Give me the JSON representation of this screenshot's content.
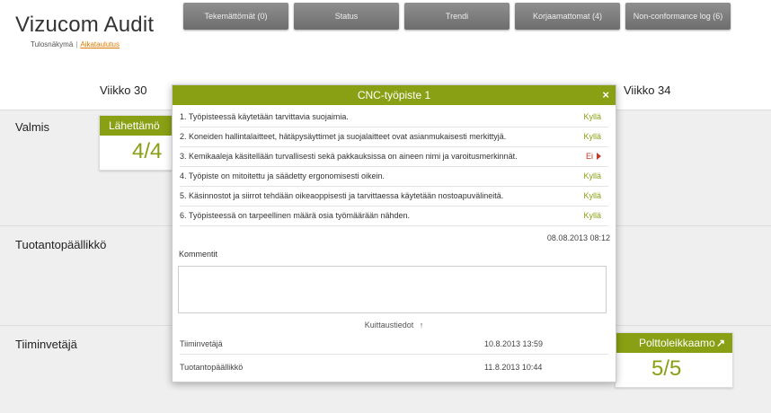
{
  "header": {
    "app_title": "Vizucom Audit",
    "subnav": {
      "current": "Tulosnäkymä",
      "separator": "|",
      "link": "Aikataulutus"
    },
    "tabs": [
      {
        "label": "Tekemättömät (0)"
      },
      {
        "label": "Status"
      },
      {
        "label": "Trendi"
      },
      {
        "label": "Korjaamattomat (4)"
      },
      {
        "label": "Non-conformance log (6)"
      }
    ]
  },
  "weeks": {
    "left": "Viikko 30",
    "right": "Viikko 34"
  },
  "rows": [
    {
      "label": "Valmis"
    },
    {
      "label": "Tuotantopäällikkö"
    },
    {
      "label": "Tiiminvetäjä"
    }
  ],
  "cards": {
    "left": {
      "title": "Lähettämö",
      "value": "4/4"
    },
    "right": {
      "title": "Polttoleikkaamo",
      "value": "5/5",
      "icon": "arrow-up-right-icon"
    }
  },
  "modal": {
    "title": "CNC-työpiste 1",
    "close_glyph": "×",
    "questions": [
      {
        "text": "1. Työpisteessä käytetään tarvittavia suojaimia.",
        "answer": "Kyllä"
      },
      {
        "text": "2. Koneiden hallintalaitteet, hätäpysäyttimet ja suojalaitteet ovat asianmukaisesti merkittyjä.",
        "answer": "Kyllä"
      },
      {
        "text": "3. Kemikaaleja käsitellään turvallisesti sekä pakkauksissa on aineen nimi ja varoitusmerkinnät.",
        "answer": "Ei"
      },
      {
        "text": "4. Työpiste on mitoitettu ja säädetty ergonomisesti oikein.",
        "answer": "Kyllä"
      },
      {
        "text": "5. Käsinnostot ja siirrot tehdään oikeaoppisesti ja tarvittaessa käytetään nostoapuvälineitä.",
        "answer": "Kyllä"
      },
      {
        "text": "6. Työpisteessä on tarpeellinen määrä osia työmäärään nähden.",
        "answer": "Kyllä"
      }
    ],
    "timestamp": "08.08.2013 08:12",
    "comment_label": "Kommentit",
    "comment_value": "",
    "ack_label": "Kuittaustiedot",
    "ack_arrow": "↑",
    "acks": [
      {
        "role": "Tiiminvetäjä",
        "time": "10.8.2013 13:59"
      },
      {
        "role": "Tuotantopäällikkö",
        "time": "11.8.2013 10:44"
      }
    ]
  },
  "colors": {
    "accent": "#8aa014",
    "negative": "#c0392b",
    "tab": "#7d7d7d"
  }
}
